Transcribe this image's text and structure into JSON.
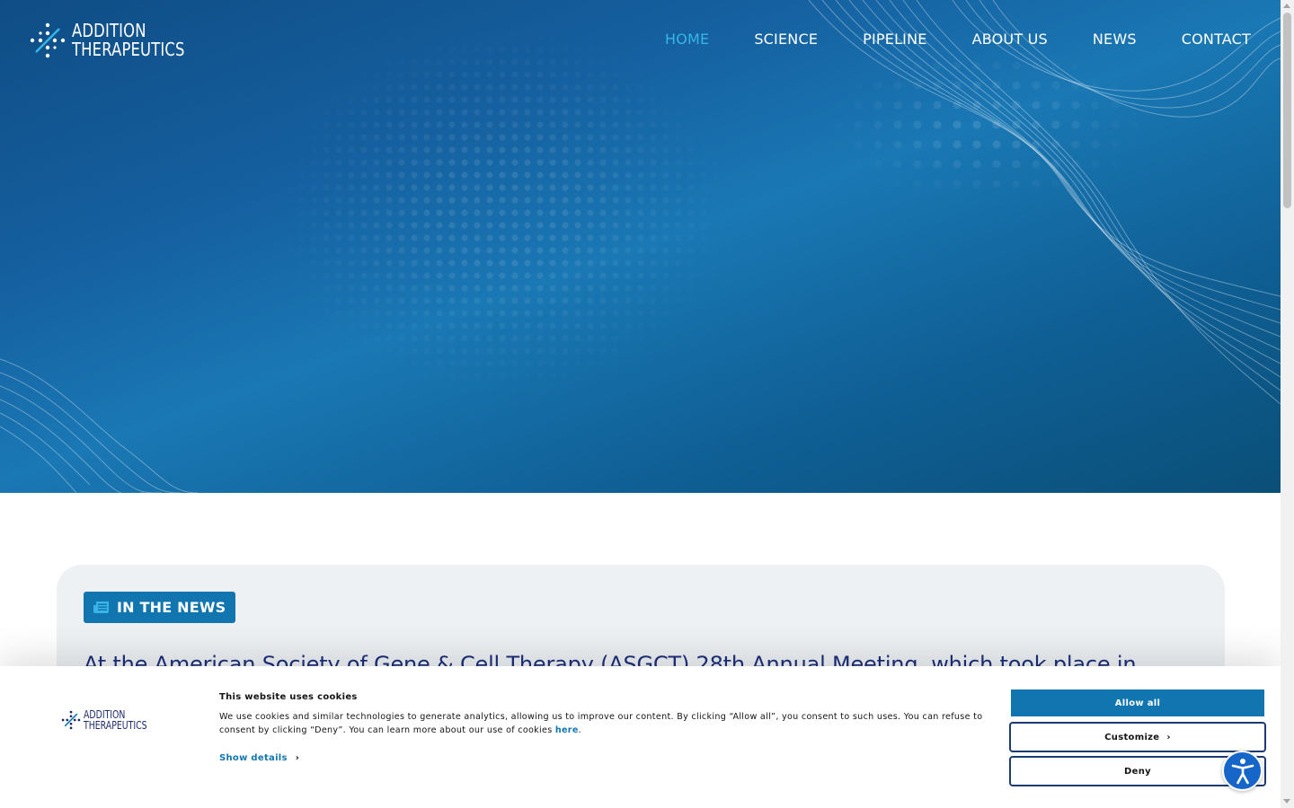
{
  "brand": {
    "line1": "ADDITION",
    "line2": "THERAPEUTICS",
    "colors": {
      "navy": "#1d2f7a",
      "accent": "#1176b0",
      "nav_active": "#37b5e6"
    }
  },
  "nav": {
    "items": [
      {
        "label": "HOME",
        "active": true
      },
      {
        "label": "SCIENCE",
        "active": false
      },
      {
        "label": "PIPELINE",
        "active": false
      },
      {
        "label": "ABOUT US",
        "active": false
      },
      {
        "label": "NEWS",
        "active": false
      },
      {
        "label": "CONTACT",
        "active": false
      }
    ]
  },
  "news": {
    "badge_icon": "newspaper-icon",
    "badge_label": "IN THE NEWS",
    "headline": "At the American Society of Gene & Cell Therapy (ASGCT) 28th Annual Meeting, which took place in"
  },
  "cookie": {
    "title": "This website uses cookies",
    "text": "We use cookies and similar technologies to generate analytics, allowing us to improve our content. By clicking “Allow all”, you consent to such uses. You can refuse to consent by clicking “Deny”. You can learn more about our use of cookies ",
    "link_label": "here",
    "text_end": ".",
    "show_details_label": "Show details",
    "allow_all_label": "Allow all",
    "customize_label": "Customize",
    "deny_label": "Deny",
    "logo_line1": "ADDITION",
    "logo_line2": "THERAPEUTICS"
  },
  "accessibility": {
    "icon": "accessibility-icon"
  }
}
